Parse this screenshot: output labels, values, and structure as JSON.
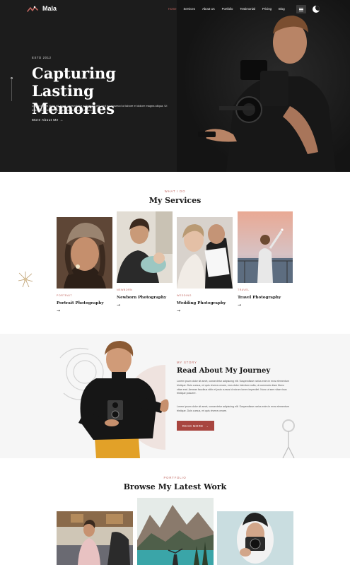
{
  "brand": {
    "name": "Mala",
    "accent": "#c0665f",
    "button_color": "#a8453f"
  },
  "nav": {
    "links": [
      "Home",
      "Services",
      "About Us",
      "Portfolio",
      "Testimonial",
      "Pricing",
      "Blog"
    ],
    "active": "Home",
    "menu_icon": "hamburger-icon",
    "theme_icon": "moon-toggle-icon"
  },
  "hero": {
    "eyebrow": "ESTD 2012",
    "title_line1": "Capturing Lasting",
    "title_line2": "Memories",
    "text": "Lorem ipsum dolor sit amet, consectetur adipiscing elit, sed do eiusmod ut labore et dolore magna aliqua. Ut enim ad minim venia mquis nostrud exercitation.",
    "link_label": "More About Me"
  },
  "services": {
    "eyebrow": "WHAT I DO",
    "title": "My Services",
    "cards": [
      {
        "category": "PORTRAIT",
        "title": "Portrait Photography"
      },
      {
        "category": "NEWBORN",
        "title": "Newborn Photography"
      },
      {
        "category": "WEDDING",
        "title": "Wedding Photography"
      },
      {
        "category": "TRAVEL",
        "title": "Travel Photography"
      }
    ]
  },
  "story": {
    "eyebrow": "MY STORY",
    "title": "Read About My Journey",
    "paragraph1": "Lorem ipsum dolor sit amet, consectetur adipiscing elit. Suspendisse varius enim in eros elementum tristique. Duis cursus, mi quis viverra ornare, eros dolor interdum nulla, ut commodo diam libero vitae erat. Aenean faucibus nibh et justo cursus id rutrum lorem imperdiet. Nunc ut sem vitae risus tristique posuere.",
    "paragraph2": "Lorem ipsum dolor sit amet, consectetur adipiscing elit. Suspendisse varius enim in eros elementum tristique. Duis cursus, mi quis viverra ornare.",
    "button_label": "READ MORE"
  },
  "portfolio": {
    "eyebrow": "PORTFOLIO",
    "title": "Browse My Latest Work"
  }
}
